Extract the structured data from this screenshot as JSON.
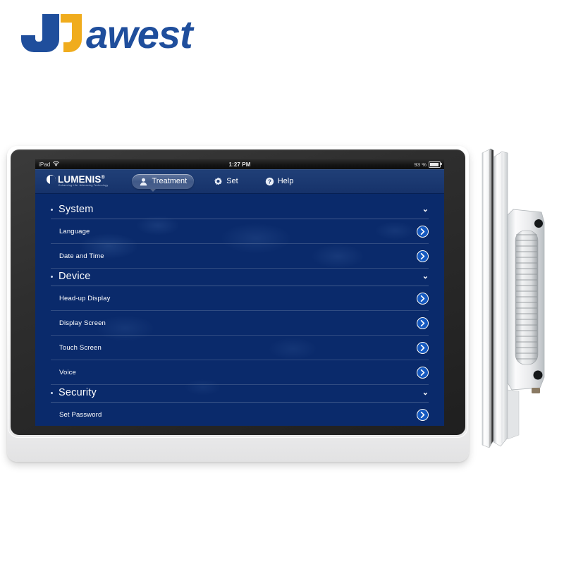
{
  "brand": {
    "name": "JAWEST",
    "colors": {
      "blue": "#1f4e9c",
      "yellow": "#f0ac1d"
    }
  },
  "device": {
    "front_view_label": "panel-pc-front-view",
    "side_view_label": "panel-pc-side-view",
    "bezel_color": "#272727",
    "shell_color": "#f7f7f7"
  },
  "screen": {
    "statusbar": {
      "carrier": "iPad",
      "wifi_icon": "wifi-icon",
      "time": "1:27 PM",
      "battery_percent": "93 %",
      "battery_icon": "battery-icon"
    },
    "navbar": {
      "logo": {
        "wordmark": "LUMENIS",
        "trademark": "®",
        "tagline": "Enhancing Life. Advancing Technology"
      },
      "items": [
        {
          "label": "Treatment",
          "icon": "person-icon",
          "active": true
        },
        {
          "label": "Set",
          "icon": "gear-icon",
          "active": false
        },
        {
          "label": "Help",
          "icon": "question-circle-icon",
          "active": false
        }
      ]
    },
    "settings": [
      {
        "group": "System",
        "expanded": true,
        "chevron": "chevron-down-icon",
        "rows": [
          {
            "label": "Language",
            "arrow": "chevron-right-circle-icon"
          },
          {
            "label": "Date and Time",
            "arrow": "chevron-right-circle-icon"
          }
        ]
      },
      {
        "group": "Device",
        "expanded": true,
        "chevron": "chevron-down-icon",
        "rows": [
          {
            "label": "Head-up Display",
            "arrow": "chevron-right-circle-icon"
          },
          {
            "label": "Display Screen",
            "arrow": "chevron-right-circle-icon"
          },
          {
            "label": "Touch Screen",
            "arrow": "chevron-right-circle-icon"
          },
          {
            "label": "Voice",
            "arrow": "chevron-right-circle-icon"
          }
        ]
      },
      {
        "group": "Security",
        "expanded": true,
        "chevron": "chevron-down-icon",
        "rows": [
          {
            "label": "Set Password",
            "arrow": "chevron-right-circle-icon"
          }
        ]
      }
    ],
    "theme": {
      "background_blue": "#12418e",
      "navbar_blue": "#1c3a72",
      "accent_blue": "#1559c0",
      "text_white": "#ffffff"
    }
  }
}
